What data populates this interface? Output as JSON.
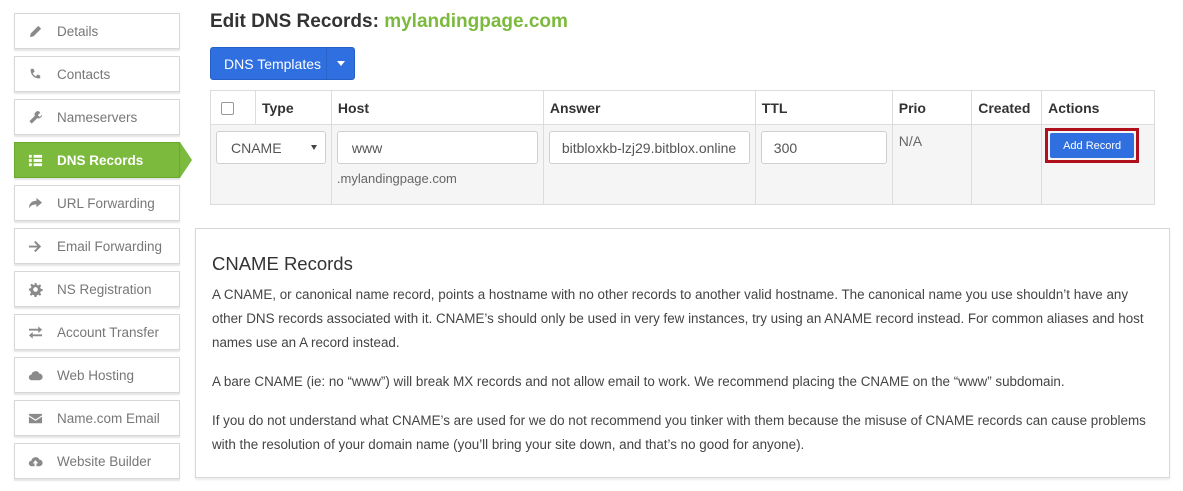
{
  "sidebar": {
    "items": [
      {
        "label": "Details",
        "icon": "pencil-icon"
      },
      {
        "label": "Contacts",
        "icon": "phone-icon"
      },
      {
        "label": "Nameservers",
        "icon": "wrench-icon"
      },
      {
        "label": "DNS Records",
        "icon": "list-icon",
        "active": true
      },
      {
        "label": "URL Forwarding",
        "icon": "share-arrow-icon"
      },
      {
        "label": "Email Forwarding",
        "icon": "arrow-right-icon"
      },
      {
        "label": "NS Registration",
        "icon": "gear-icon"
      },
      {
        "label": "Account Transfer",
        "icon": "transfer-arrows-icon"
      },
      {
        "label": "Web Hosting",
        "icon": "cloud-icon"
      },
      {
        "label": "Name.com Email",
        "icon": "envelope-icon"
      },
      {
        "label": "Website Builder",
        "icon": "cloud-upload-icon"
      }
    ]
  },
  "header": {
    "title_prefix": "Edit DNS Records:",
    "domain": "mylandingpage.com"
  },
  "toolbar": {
    "templates_label": "DNS Templates"
  },
  "table": {
    "columns": [
      "Type",
      "Host",
      "Answer",
      "TTL",
      "Prio",
      "Created",
      "Actions"
    ],
    "new_record": {
      "type": "CNAME",
      "host": "www",
      "host_suffix": ".mylandingpage.com",
      "answer": "bitbloxkb-lzj29.bitblox.online",
      "ttl": "300",
      "prio": "N/A",
      "created": "",
      "action_label": "Add Record"
    }
  },
  "info": {
    "heading": "CNAME Records",
    "paragraphs": [
      "A CNAME, or canonical name record, points a hostname with no other records to another valid hostname. The canonical name you use shouldn’t have any other DNS records associated with it. CNAME’s should only be used in very few instances, try using an ANAME record instead. For common aliases and host names use an A record instead.",
      "A bare CNAME (ie: no “www”) will break MX records and not allow email to work. We recommend placing the CNAME on the “www” subdomain.",
      "If you do not understand what CNAME’s are used for we do not recommend you tinker with them because the misuse of CNAME records can cause problems with the resolution of your domain name (you’ll bring your site down, and that’s no good for anyone)."
    ]
  },
  "colors": {
    "brand_green": "#7cba3d",
    "primary_blue": "#2f6fe0",
    "highlight_red": "#b0101e"
  }
}
